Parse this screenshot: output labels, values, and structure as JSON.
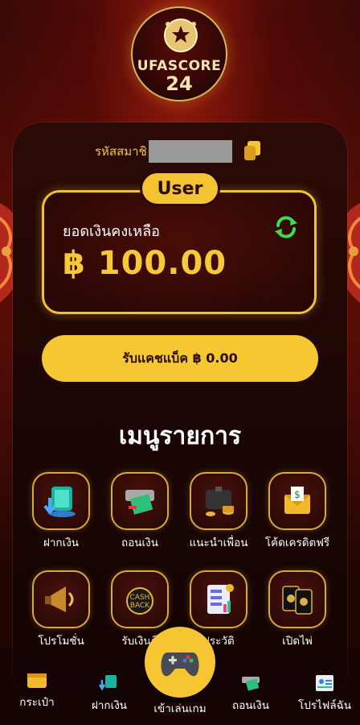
{
  "logo": {
    "name": "UFASCORE",
    "number": "24"
  },
  "member": {
    "label": "รหัสสมาชิ"
  },
  "user_tab": "User",
  "balance": {
    "label": "ยอดเงินคงเหลือ",
    "value": "฿ 100.00"
  },
  "cashback_button": "รับแคชแบ็ค ฿ 0.00",
  "menu_title": "เมนูรายการ",
  "menu": [
    {
      "label": "ฝากเงิน",
      "icon": "deposit-icon"
    },
    {
      "label": "ถอนเงิน",
      "icon": "withdraw-icon"
    },
    {
      "label": "แนะนำเพื่อน",
      "icon": "refer-friend-icon"
    },
    {
      "label": "โค้ดเครดิตฟรี",
      "icon": "free-credit-code-icon"
    },
    {
      "label": "โปรโมชั่น",
      "icon": "megaphone-icon"
    },
    {
      "label": "รับเงินคื",
      "icon": "cashback-icon"
    },
    {
      "label": "ประวัติ",
      "icon": "history-icon"
    },
    {
      "label": "เปิดไพ่",
      "icon": "cards-icon"
    }
  ],
  "bottom_nav": [
    {
      "label": "กระเป๋า",
      "icon": "wallet-icon"
    },
    {
      "label": "ฝากเงิน",
      "icon": "deposit-icon"
    },
    {
      "label": "เข้าเล่นเกม",
      "icon": "gamepad-icon"
    },
    {
      "label": "ถอนเงิน",
      "icon": "withdraw-icon"
    },
    {
      "label": "โปรไฟล์ฉัน",
      "icon": "profile-icon"
    }
  ],
  "colors": {
    "accent": "#f5c532",
    "background": "#2a0604",
    "balance": "#f7c936",
    "refresh": "#3ddc4b"
  }
}
